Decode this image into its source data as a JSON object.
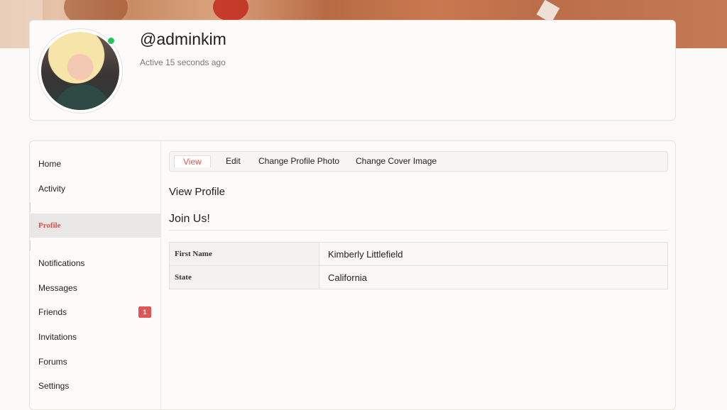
{
  "profile": {
    "username": "@adminkim",
    "active_status": "Active 15 seconds ago"
  },
  "sidebar": {
    "items": [
      {
        "label": "Home"
      },
      {
        "label": "Activity"
      },
      {
        "label": "Profile",
        "active": true
      },
      {
        "label": "Notifications"
      },
      {
        "label": "Messages"
      },
      {
        "label": "Friends",
        "badge": "1"
      },
      {
        "label": "Invitations"
      },
      {
        "label": "Forums"
      },
      {
        "label": "Settings"
      }
    ]
  },
  "subnav": {
    "tabs": [
      {
        "label": "View",
        "active": true
      },
      {
        "label": "Edit"
      },
      {
        "label": "Change Profile Photo"
      },
      {
        "label": "Change Cover Image"
      }
    ]
  },
  "main": {
    "section_title": "View Profile",
    "group_title": "Join Us!",
    "fields": [
      {
        "label": "First Name",
        "value": "Kimberly Littlefield"
      },
      {
        "label": "State",
        "value": "California"
      }
    ]
  },
  "colors": {
    "accent": "#e05656",
    "online": "#22c55e"
  }
}
